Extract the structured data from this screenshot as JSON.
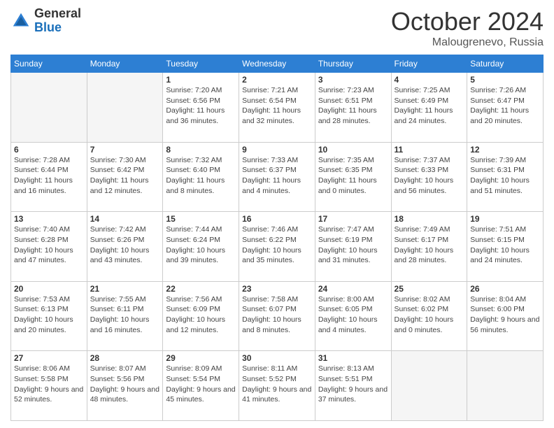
{
  "header": {
    "logo_general": "General",
    "logo_blue": "Blue",
    "month_title": "October 2024",
    "location": "Malougrenevo, Russia"
  },
  "weekdays": [
    "Sunday",
    "Monday",
    "Tuesday",
    "Wednesday",
    "Thursday",
    "Friday",
    "Saturday"
  ],
  "weeks": [
    [
      {
        "day": "",
        "info": ""
      },
      {
        "day": "",
        "info": ""
      },
      {
        "day": "1",
        "info": "Sunrise: 7:20 AM\nSunset: 6:56 PM\nDaylight: 11 hours and 36 minutes."
      },
      {
        "day": "2",
        "info": "Sunrise: 7:21 AM\nSunset: 6:54 PM\nDaylight: 11 hours and 32 minutes."
      },
      {
        "day": "3",
        "info": "Sunrise: 7:23 AM\nSunset: 6:51 PM\nDaylight: 11 hours and 28 minutes."
      },
      {
        "day": "4",
        "info": "Sunrise: 7:25 AM\nSunset: 6:49 PM\nDaylight: 11 hours and 24 minutes."
      },
      {
        "day": "5",
        "info": "Sunrise: 7:26 AM\nSunset: 6:47 PM\nDaylight: 11 hours and 20 minutes."
      }
    ],
    [
      {
        "day": "6",
        "info": "Sunrise: 7:28 AM\nSunset: 6:44 PM\nDaylight: 11 hours and 16 minutes."
      },
      {
        "day": "7",
        "info": "Sunrise: 7:30 AM\nSunset: 6:42 PM\nDaylight: 11 hours and 12 minutes."
      },
      {
        "day": "8",
        "info": "Sunrise: 7:32 AM\nSunset: 6:40 PM\nDaylight: 11 hours and 8 minutes."
      },
      {
        "day": "9",
        "info": "Sunrise: 7:33 AM\nSunset: 6:37 PM\nDaylight: 11 hours and 4 minutes."
      },
      {
        "day": "10",
        "info": "Sunrise: 7:35 AM\nSunset: 6:35 PM\nDaylight: 11 hours and 0 minutes."
      },
      {
        "day": "11",
        "info": "Sunrise: 7:37 AM\nSunset: 6:33 PM\nDaylight: 10 hours and 56 minutes."
      },
      {
        "day": "12",
        "info": "Sunrise: 7:39 AM\nSunset: 6:31 PM\nDaylight: 10 hours and 51 minutes."
      }
    ],
    [
      {
        "day": "13",
        "info": "Sunrise: 7:40 AM\nSunset: 6:28 PM\nDaylight: 10 hours and 47 minutes."
      },
      {
        "day": "14",
        "info": "Sunrise: 7:42 AM\nSunset: 6:26 PM\nDaylight: 10 hours and 43 minutes."
      },
      {
        "day": "15",
        "info": "Sunrise: 7:44 AM\nSunset: 6:24 PM\nDaylight: 10 hours and 39 minutes."
      },
      {
        "day": "16",
        "info": "Sunrise: 7:46 AM\nSunset: 6:22 PM\nDaylight: 10 hours and 35 minutes."
      },
      {
        "day": "17",
        "info": "Sunrise: 7:47 AM\nSunset: 6:19 PM\nDaylight: 10 hours and 31 minutes."
      },
      {
        "day": "18",
        "info": "Sunrise: 7:49 AM\nSunset: 6:17 PM\nDaylight: 10 hours and 28 minutes."
      },
      {
        "day": "19",
        "info": "Sunrise: 7:51 AM\nSunset: 6:15 PM\nDaylight: 10 hours and 24 minutes."
      }
    ],
    [
      {
        "day": "20",
        "info": "Sunrise: 7:53 AM\nSunset: 6:13 PM\nDaylight: 10 hours and 20 minutes."
      },
      {
        "day": "21",
        "info": "Sunrise: 7:55 AM\nSunset: 6:11 PM\nDaylight: 10 hours and 16 minutes."
      },
      {
        "day": "22",
        "info": "Sunrise: 7:56 AM\nSunset: 6:09 PM\nDaylight: 10 hours and 12 minutes."
      },
      {
        "day": "23",
        "info": "Sunrise: 7:58 AM\nSunset: 6:07 PM\nDaylight: 10 hours and 8 minutes."
      },
      {
        "day": "24",
        "info": "Sunrise: 8:00 AM\nSunset: 6:05 PM\nDaylight: 10 hours and 4 minutes."
      },
      {
        "day": "25",
        "info": "Sunrise: 8:02 AM\nSunset: 6:02 PM\nDaylight: 10 hours and 0 minutes."
      },
      {
        "day": "26",
        "info": "Sunrise: 8:04 AM\nSunset: 6:00 PM\nDaylight: 9 hours and 56 minutes."
      }
    ],
    [
      {
        "day": "27",
        "info": "Sunrise: 8:06 AM\nSunset: 5:58 PM\nDaylight: 9 hours and 52 minutes."
      },
      {
        "day": "28",
        "info": "Sunrise: 8:07 AM\nSunset: 5:56 PM\nDaylight: 9 hours and 48 minutes."
      },
      {
        "day": "29",
        "info": "Sunrise: 8:09 AM\nSunset: 5:54 PM\nDaylight: 9 hours and 45 minutes."
      },
      {
        "day": "30",
        "info": "Sunrise: 8:11 AM\nSunset: 5:52 PM\nDaylight: 9 hours and 41 minutes."
      },
      {
        "day": "31",
        "info": "Sunrise: 8:13 AM\nSunset: 5:51 PM\nDaylight: 9 hours and 37 minutes."
      },
      {
        "day": "",
        "info": ""
      },
      {
        "day": "",
        "info": ""
      }
    ]
  ]
}
